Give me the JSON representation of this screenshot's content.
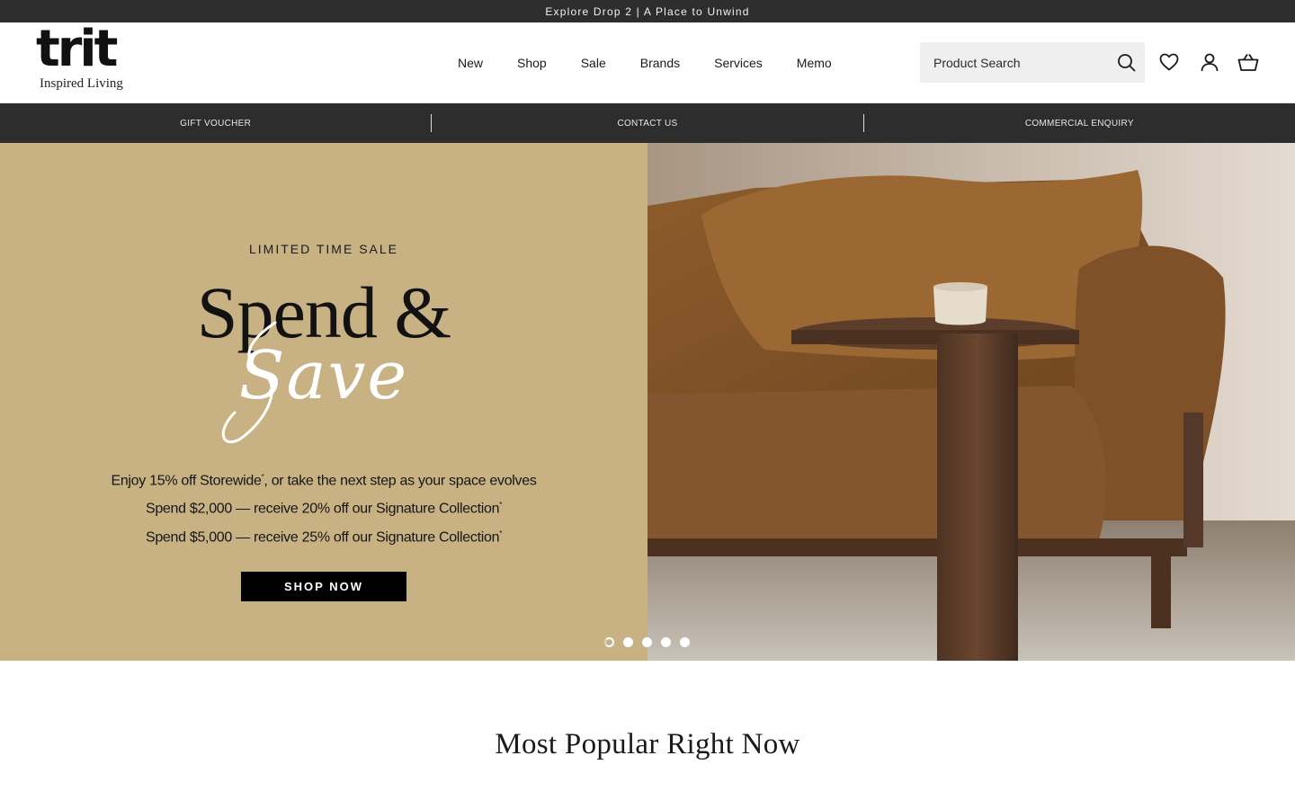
{
  "announcement": {
    "text": "Explore Drop 2 | A Place to Unwind"
  },
  "brand": {
    "name": "trit",
    "tagline": "Inspired Living"
  },
  "nav": {
    "items": [
      {
        "label": "New"
      },
      {
        "label": "Shop"
      },
      {
        "label": "Sale"
      },
      {
        "label": "Brands"
      },
      {
        "label": "Services"
      },
      {
        "label": "Memo"
      }
    ]
  },
  "search": {
    "placeholder": "Product Search",
    "icon": "search-icon"
  },
  "header_icons": [
    "heart-icon",
    "user-icon",
    "basket-icon"
  ],
  "utility": {
    "items": [
      {
        "label": "GIFT VOUCHER"
      },
      {
        "label": "CONTACT US"
      },
      {
        "label": "COMMERCIAL ENQUIRY"
      }
    ]
  },
  "hero": {
    "eyebrow": "LIMITED TIME SALE",
    "headline": "Spend &",
    "script": "Save",
    "lines": [
      "Enjoy 15% off Storewide",
      ", or take the next step as your space evolves",
      "Spend $2,000 — receive 20% off our Signature Collection",
      "Spend $5,000 — receive 25% off our Signature Collection"
    ],
    "footnote_mark": "*",
    "cta": "SHOP NOW",
    "background_color": "#c8b284",
    "slides": {
      "count": 5,
      "active": 1
    }
  },
  "section": {
    "title": "Most Popular Right Now"
  },
  "colors": {
    "bar": "#2d2d2d",
    "hero_tan": "#c8b284",
    "cta_bg": "#000000"
  }
}
